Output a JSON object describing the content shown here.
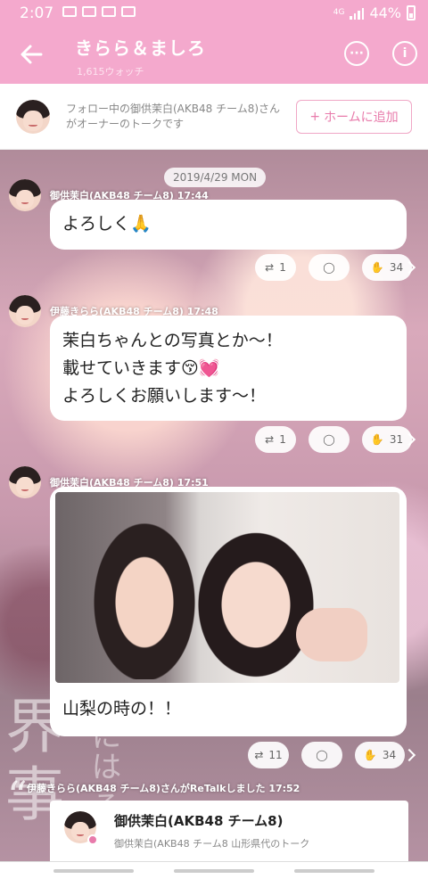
{
  "status_bar": {
    "time": "2:07",
    "network": "4G",
    "battery": "44%"
  },
  "header": {
    "title": "きらら＆ましろ",
    "watch_count": "1,615ウォッチ"
  },
  "owner_banner": {
    "text": "フォロー中の御供茉白(AKB48 チーム8)さんがオーナーのトークです",
    "button_label": "ホームに追加",
    "button_icon": "+"
  },
  "timeline": {
    "date": "2019/4/29 MON",
    "posts": [
      {
        "author": "御供茉白(AKB48 チーム8)",
        "time": "17:44",
        "text": "よろしく🙏",
        "retalk_count": "1",
        "clap_count": "34"
      },
      {
        "author": "伊藤きらら(AKB48 チーム8)",
        "time": "17:48",
        "lines": [
          "茉白ちゃんとの写真とか〜！",
          "載せていきます😚💓",
          "よろしくお願いします〜！"
        ],
        "retalk_count": "1",
        "clap_count": "31"
      },
      {
        "author": "御供茉白(AKB48 チーム8)",
        "time": "17:51",
        "caption": "山梨の時の！！",
        "retalk_count": "11",
        "clap_count": "34"
      }
    ],
    "retalk": {
      "label": "伊藤きらら(AKB48 チーム8)さんがReTalkしました",
      "time": "17:52",
      "card_name": "御供茉白(AKB48 チーム8)",
      "card_sub": "御供茉白(AKB48 チーム8 山形県代のトーク"
    },
    "background_text": {
      "kanji": "界\n事",
      "kana": "には　る"
    }
  },
  "colors": {
    "accent": "#f4a9cd",
    "button_text": "#e87bab"
  },
  "icons": [
    "back-arrow-icon",
    "comment-bubble-icon",
    "info-icon",
    "retalk-icon",
    "comment-icon",
    "clap-icon",
    "chevron-right-icon"
  ]
}
